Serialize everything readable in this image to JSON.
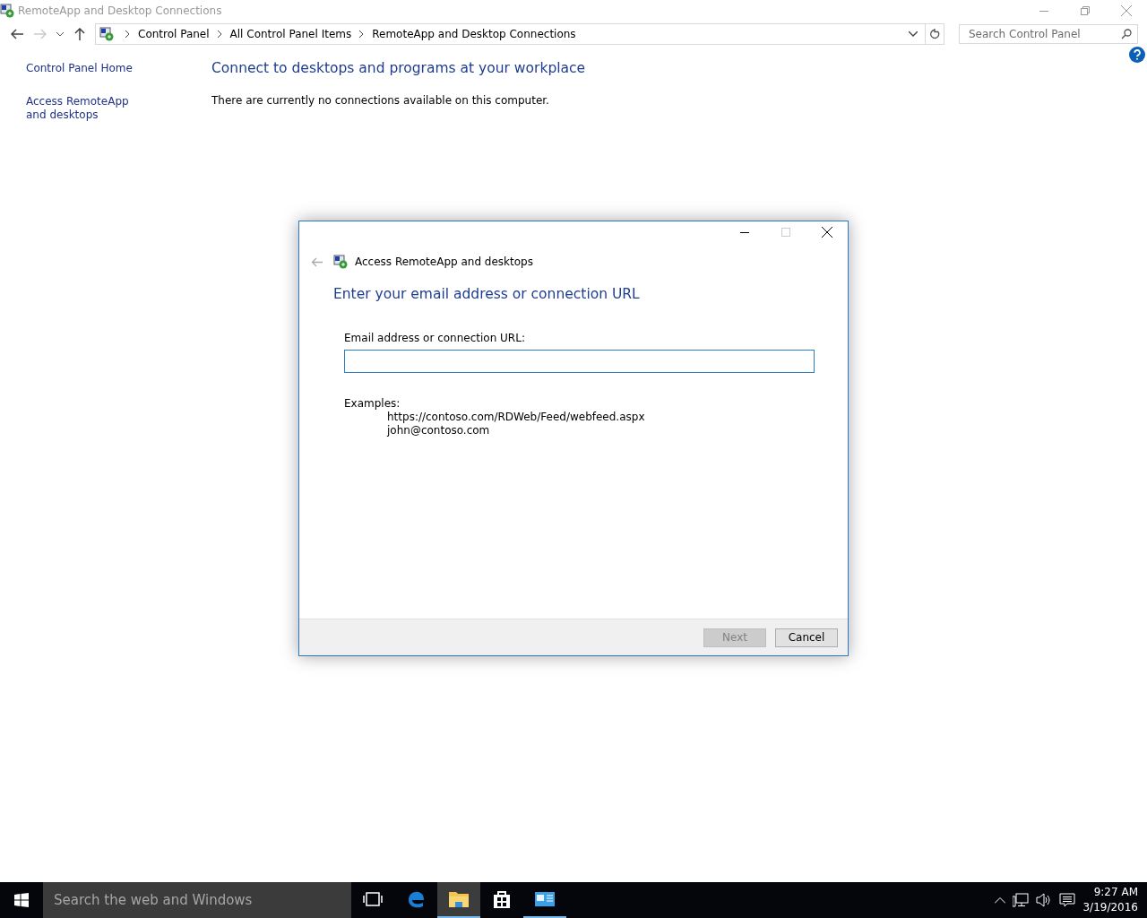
{
  "window": {
    "title": "RemoteApp and Desktop Connections"
  },
  "breadcrumb": [
    "Control Panel",
    "All Control Panel Items",
    "RemoteApp and Desktop Connections"
  ],
  "search": {
    "placeholder": "Search Control Panel"
  },
  "sidebar": {
    "items": [
      "Control Panel Home",
      "Access RemoteApp and desktops"
    ]
  },
  "content": {
    "heading": "Connect to desktops and programs at your workplace",
    "message": "There are currently no connections available on this computer."
  },
  "dialog": {
    "title": "Access RemoteApp and desktops",
    "heading": "Enter your email address or connection URL",
    "field_label": "Email address or connection URL:",
    "examples_label": "Examples:",
    "examples": [
      "https://contoso.com/RDWeb/Feed/webfeed.aspx",
      "john@contoso.com"
    ],
    "buttons": [
      {
        "label": "Next",
        "disabled": true
      },
      {
        "label": "Cancel",
        "disabled": false
      }
    ]
  },
  "taskbar": {
    "search_placeholder": "Search the web and Windows",
    "apps": [
      {
        "kind": "edge",
        "running": false,
        "selected": false
      },
      {
        "kind": "explorer",
        "running": true,
        "selected": true
      },
      {
        "kind": "store",
        "running": false,
        "selected": false
      },
      {
        "kind": "remote",
        "running": true,
        "selected": false
      }
    ],
    "time": "9:27 AM",
    "date": "3/19/2016"
  }
}
